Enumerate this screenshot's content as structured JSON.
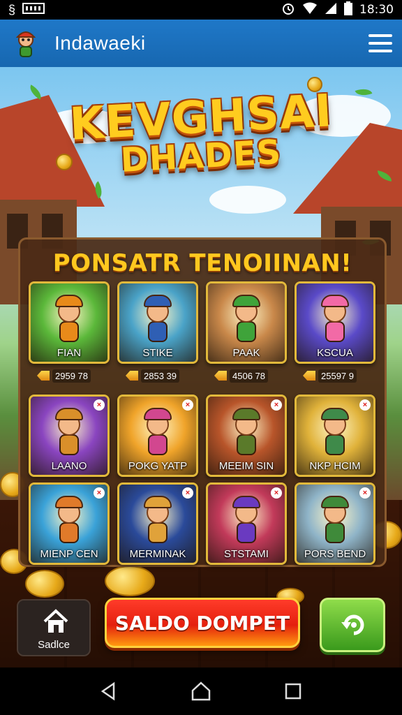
{
  "status_bar": {
    "time": "18:30",
    "left_icons": [
      "app-logo-icon",
      "notification-icon"
    ],
    "right_icons": [
      "alarm-icon",
      "wifi-icon",
      "signal-icon",
      "battery-icon"
    ]
  },
  "app_bar": {
    "title": "Indawaeki",
    "menu_icon": "hamburger-menu-icon"
  },
  "game": {
    "title_line1": "KEVGHSAI",
    "title_line2": "DHADES"
  },
  "panel": {
    "title": "PONSATR TENOIINAN!"
  },
  "cards": [
    {
      "name": "FIAN",
      "value": "2959 78",
      "color": "#5bb83a",
      "accent": "#e88a1a"
    },
    {
      "name": "STIKE",
      "value": "2853 39",
      "color": "#4aa3c8",
      "accent": "#2f5fb4"
    },
    {
      "name": "PAAK",
      "value": "4506 78",
      "color": "#c9884a",
      "accent": "#3fa33a"
    },
    {
      "name": "KSCUA",
      "value": "25597 9",
      "color": "#5a4ac8",
      "accent": "#f26aa6"
    },
    {
      "name": "LAANO",
      "value": "",
      "color": "#8a45c0",
      "accent": "#d98f2a"
    },
    {
      "name": "POKG YATP",
      "value": "",
      "color": "#f0a42a",
      "accent": "#d2478f"
    },
    {
      "name": "MEEIM SIN",
      "value": "",
      "color": "#b8552a",
      "accent": "#5a7a2a"
    },
    {
      "name": "NKP HCIM",
      "value": "",
      "color": "#e0b23a",
      "accent": "#3f8a4a"
    },
    {
      "name": "MIENP CEN",
      "value": "",
      "color": "#3aa2d8",
      "accent": "#e07a2a"
    },
    {
      "name": "MERMINAK",
      "value": "",
      "color": "#2a4a9a",
      "accent": "#e0a23a"
    },
    {
      "name": "STSTAMI",
      "value": "",
      "color": "#c23a5a",
      "accent": "#6a3ac0"
    },
    {
      "name": "PORS BEND",
      "value": "",
      "color": "#8fb4c8",
      "accent": "#3f8a3a"
    }
  ],
  "bottom": {
    "home_label": "Sadlce",
    "saldo_label": "SALDO DOMPET",
    "action_icon": "rotate-cycle-icon"
  },
  "nav": {
    "icons": [
      "back-icon",
      "home-icon",
      "recents-icon"
    ]
  }
}
